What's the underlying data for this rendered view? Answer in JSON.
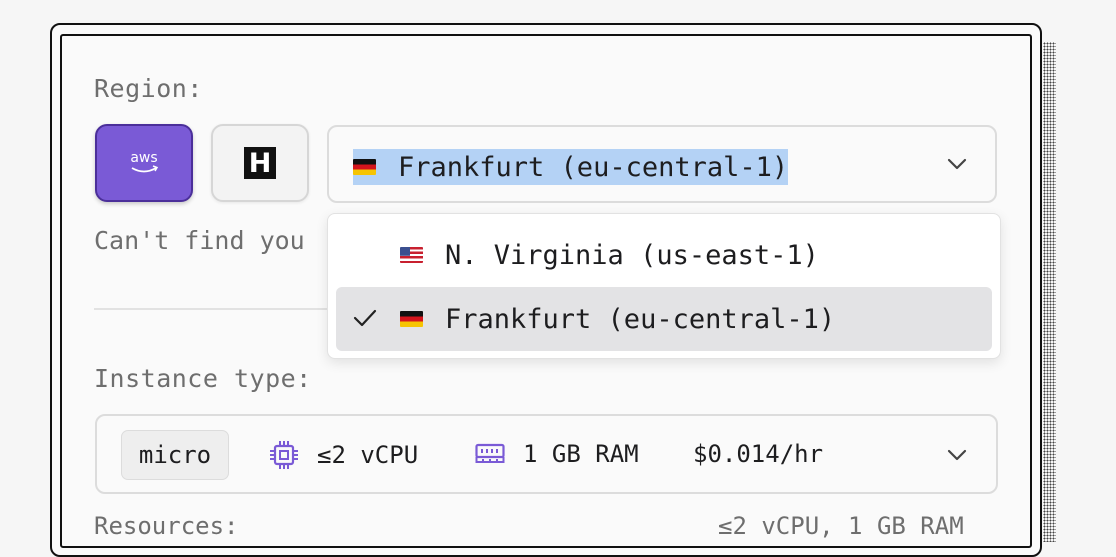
{
  "region": {
    "label": "Region:",
    "providers": [
      {
        "name": "aws",
        "icon": "aws-logo-icon",
        "selected": true
      },
      {
        "name": "H",
        "icon": "h-logo-icon",
        "selected": false
      }
    ],
    "selected_value": "Frankfurt (eu-central-1)",
    "selected_flag": "germany-flag-icon",
    "options": [
      {
        "label": "N. Virginia (us-east-1)",
        "flag": "us-flag-icon",
        "selected": false
      },
      {
        "label": "Frankfurt (eu-central-1)",
        "flag": "germany-flag-icon",
        "selected": true
      }
    ],
    "hint": "Can't find you"
  },
  "instance": {
    "label": "Instance type:",
    "size": "micro",
    "vcpu": "≤2 vCPU",
    "ram": "1 GB RAM",
    "price": "$0.014/hr"
  },
  "resources": {
    "label": "Resources:",
    "value": "≤2 vCPU, 1 GB RAM"
  },
  "colors": {
    "accent": "#7a5ad6",
    "highlight": "#b4d2f5",
    "option_selected_bg": "#e3e3e5"
  }
}
